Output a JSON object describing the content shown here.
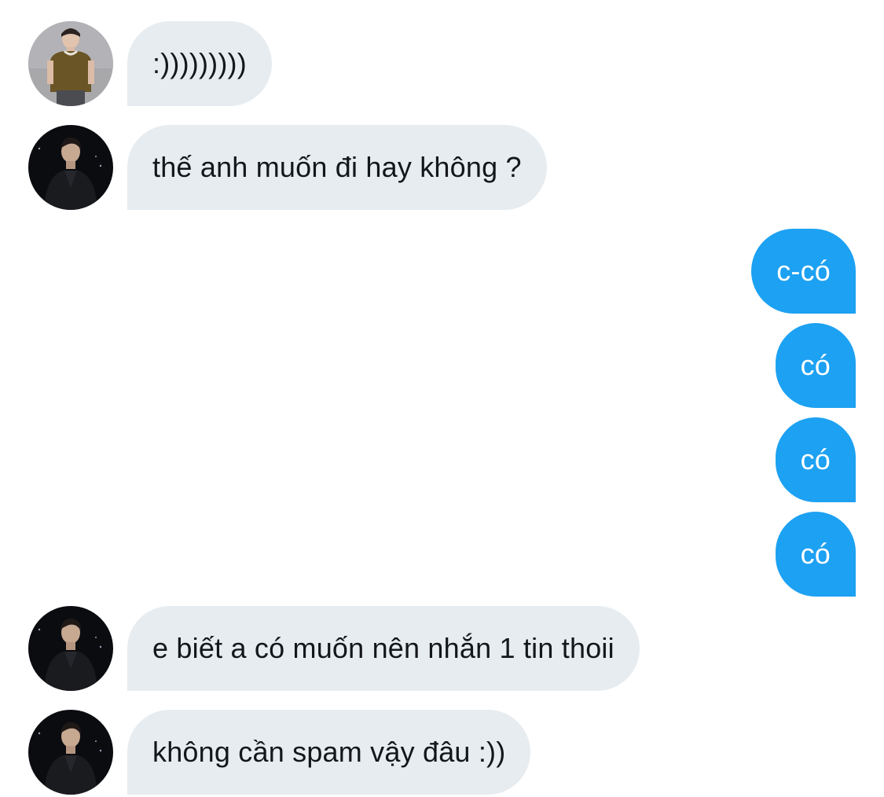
{
  "messages": [
    {
      "direction": "incoming",
      "avatar": "avatar-olive-shirt",
      "text": ":)))))))))"
    },
    {
      "direction": "incoming",
      "avatar": "avatar-dark-jacket",
      "text": "thế anh muốn đi hay không ?"
    },
    {
      "direction": "outgoing",
      "text": "c-có"
    },
    {
      "direction": "outgoing",
      "text": "có"
    },
    {
      "direction": "outgoing",
      "text": "có"
    },
    {
      "direction": "outgoing",
      "text": "có"
    },
    {
      "direction": "incoming",
      "avatar": "avatar-dark-jacket",
      "text": "e biết a có muốn nên nhắn 1 tin thoii"
    },
    {
      "direction": "incoming",
      "avatar": "avatar-dark-jacket",
      "text": "không cần spam vậy đâu :))"
    }
  ],
  "colors": {
    "incoming_bubble": "#e6ecf0",
    "incoming_text": "#14171a",
    "outgoing_bubble": "#1da1f2",
    "outgoing_text": "#ffffff",
    "background": "#ffffff"
  }
}
